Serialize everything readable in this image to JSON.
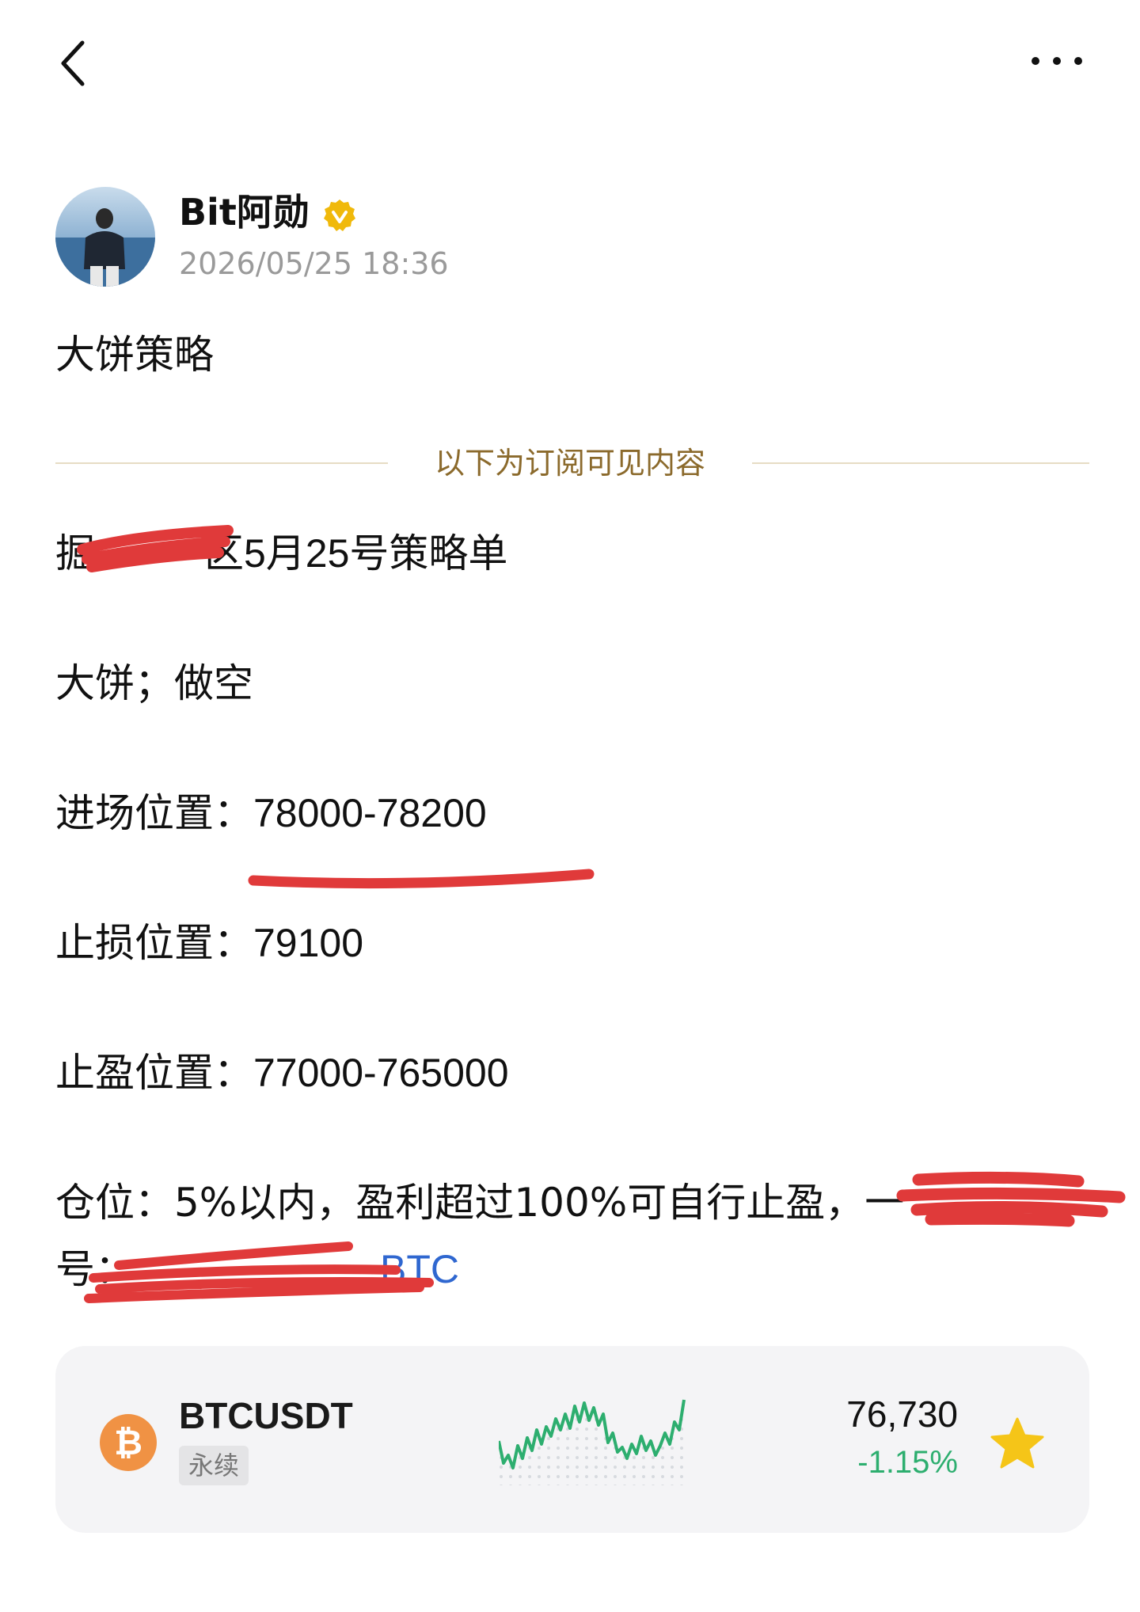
{
  "nav": {
    "back_icon": "chevron-left-icon",
    "more_icon": "more-horizontal-icon"
  },
  "author": {
    "name": "Bit阿勋",
    "verified": true,
    "verified_color": "#f0b90b",
    "timestamp": "2026/05/25 18:36"
  },
  "post": {
    "title": "大饼策略",
    "divider_label": "以下为订阅可见内容",
    "line1_visible_start": "掘",
    "line1_visible_end": "区5月25号策略单",
    "direction": "大饼；做空",
    "entry_label": "进场位置：",
    "entry_value": "78000-78200",
    "stop_loss_label": "止损位置：",
    "stop_loss_value": "79100",
    "take_profit_label": "止盈位置：",
    "take_profit_value": "77000-765000",
    "position_text": "仓位：5%以内，盈利超过100%可自行止盈，一",
    "position_line2_start": "号：",
    "hashtag_link": "BTC"
  },
  "ticker": {
    "symbol": "BTCUSDT",
    "contract_type": "永续",
    "price": "76,730",
    "change": "-1.15%",
    "change_color": "#2dae6f",
    "coin_icon": "bitcoin-icon",
    "favorite_icon": "star-icon",
    "favorite_color": "#f5c518"
  }
}
